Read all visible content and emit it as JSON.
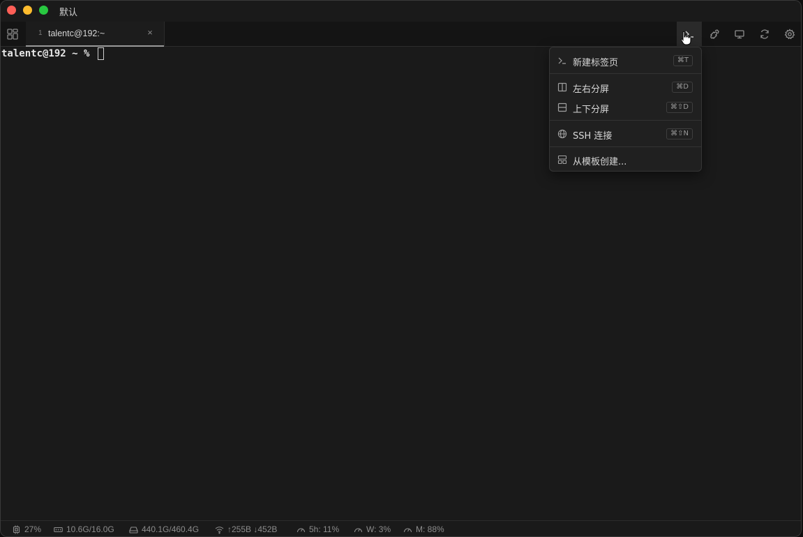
{
  "window": {
    "title": "默认"
  },
  "tab": {
    "index": "1",
    "title": "talentc@192:~",
    "close": "×"
  },
  "toolbar": {
    "icons": [
      "tabs-overview-icon",
      "new-terminal-icon",
      "plugins-icon",
      "monitor-icon",
      "sync-icon",
      "settings-icon"
    ]
  },
  "terminal": {
    "prompt": "talentc@192 ~ % "
  },
  "menu": {
    "items": [
      {
        "label": "新建标签页",
        "shortcut": "⌘T",
        "icon": "terminal-prompt-icon"
      },
      {
        "label": "左右分屏",
        "shortcut": "⌘D",
        "icon": "split-vertical-icon"
      },
      {
        "label": "上下分屏",
        "shortcut": "⌘⇧D",
        "icon": "split-horizontal-icon"
      },
      {
        "label": "SSH 连接",
        "shortcut": "⌘⇧N",
        "icon": "globe-icon"
      },
      {
        "label": "从模板创建...",
        "shortcut": "",
        "icon": "template-icon"
      }
    ]
  },
  "status": {
    "cpu": "27%",
    "memory": "10.6G/16.0G",
    "disk": "440.1G/460.4G",
    "network": "↑255B ↓452B",
    "usage_5h": "5h: 11%",
    "usage_w": "W: 3%",
    "usage_m": "M: 88%"
  },
  "colors": {
    "background": "#1a1a1a",
    "menu": "#202020",
    "text": "#d8d8d8"
  }
}
